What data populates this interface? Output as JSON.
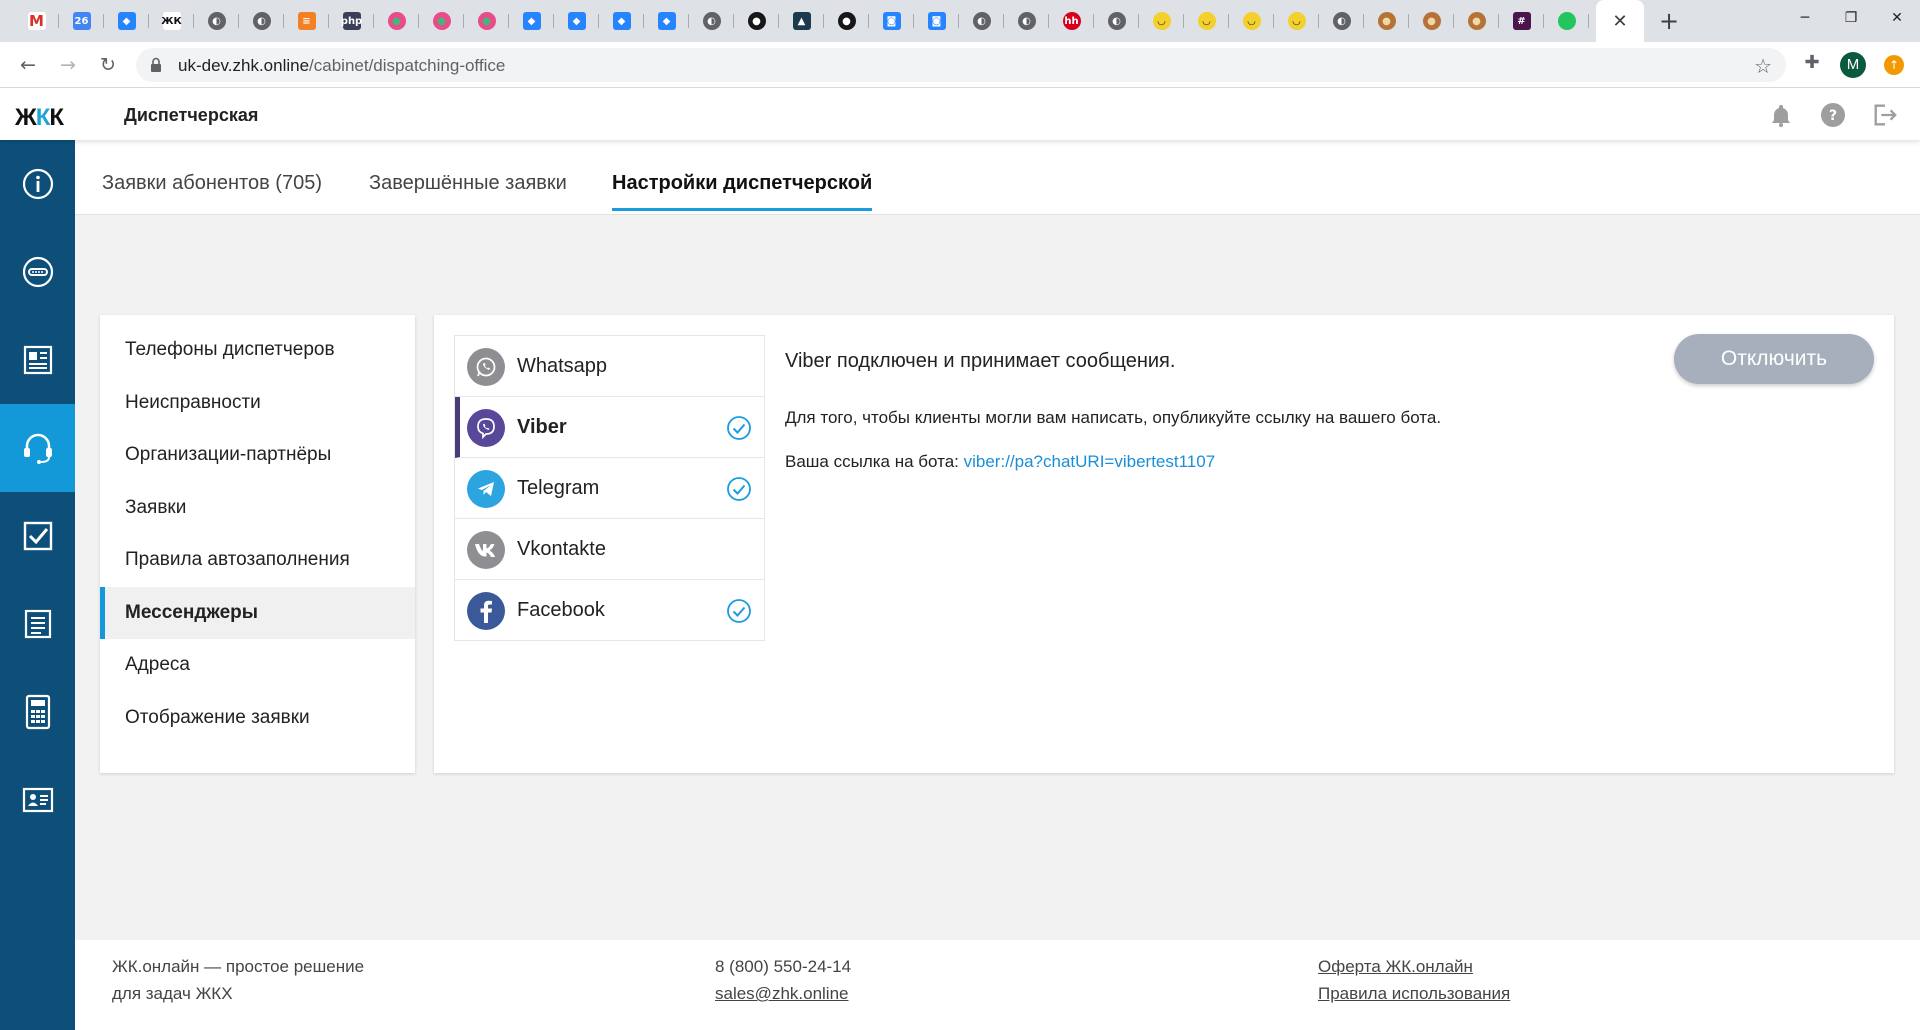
{
  "browser": {
    "url_host": "uk-dev.zhk.online",
    "url_path": "/cabinet/dispatching-office",
    "profile_initial": "M",
    "favicons": [
      {
        "icon": "gmail-icon",
        "color": "#ffffff",
        "text": "M",
        "fg": "#d93025"
      },
      {
        "icon": "calendar-icon",
        "color": "#4285f4",
        "text": "26",
        "fg": "#ffffff"
      },
      {
        "icon": "jira-icon",
        "color": "#2684ff",
        "text": "◆",
        "fg": "#ffffff"
      },
      {
        "icon": "zhk-icon",
        "color": "#ffffff",
        "text": "ЖК",
        "fg": "#111111"
      },
      {
        "icon": "globe-icon",
        "color": "#5f6368",
        "text": "◐",
        "fg": "#ffffff"
      },
      {
        "icon": "globe-icon",
        "color": "#5f6368",
        "text": "◐",
        "fg": "#ffffff"
      },
      {
        "icon": "stackoverflow-icon",
        "color": "#f48024",
        "text": "≡",
        "fg": "#ffffff"
      },
      {
        "icon": "php-icon",
        "color": "#3a3f58",
        "text": "php",
        "fg": "#ffffff"
      },
      {
        "icon": "dots-icon",
        "color": "#e94b8b",
        "text": "●",
        "fg": "#43b77a"
      },
      {
        "icon": "dots-icon",
        "color": "#e94b8b",
        "text": "●",
        "fg": "#43b77a"
      },
      {
        "icon": "dots-icon",
        "color": "#e94b8b",
        "text": "●",
        "fg": "#43b77a"
      },
      {
        "icon": "jira-icon",
        "color": "#2684ff",
        "text": "◆",
        "fg": "#ffffff"
      },
      {
        "icon": "jira-icon",
        "color": "#2684ff",
        "text": "◆",
        "fg": "#ffffff"
      },
      {
        "icon": "jira-icon",
        "color": "#2684ff",
        "text": "◆",
        "fg": "#ffffff"
      },
      {
        "icon": "jira-icon",
        "color": "#2684ff",
        "text": "◆",
        "fg": "#ffffff"
      },
      {
        "icon": "globe-icon",
        "color": "#5f6368",
        "text": "◐",
        "fg": "#ffffff"
      },
      {
        "icon": "github-icon",
        "color": "#181717",
        "text": "●",
        "fg": "#ffffff"
      },
      {
        "icon": "fire-icon",
        "color": "#1b3a4b",
        "text": "▲",
        "fg": "#ffffff"
      },
      {
        "icon": "github-icon",
        "color": "#181717",
        "text": "●",
        "fg": "#ffffff"
      },
      {
        "icon": "bitbucket-icon",
        "color": "#2684ff",
        "text": "◙",
        "fg": "#ffffff"
      },
      {
        "icon": "bitbucket-icon",
        "color": "#2684ff",
        "text": "◙",
        "fg": "#ffffff"
      },
      {
        "icon": "globe-icon",
        "color": "#5f6368",
        "text": "◐",
        "fg": "#ffffff"
      },
      {
        "icon": "globe-icon",
        "color": "#5f6368",
        "text": "◐",
        "fg": "#ffffff"
      },
      {
        "icon": "hh-icon",
        "color": "#d6001c",
        "text": "hh",
        "fg": "#ffffff"
      },
      {
        "icon": "globe-icon",
        "color": "#5f6368",
        "text": "◐",
        "fg": "#ffffff"
      },
      {
        "icon": "smiley-icon",
        "color": "#f3d02c",
        "text": "◡",
        "fg": "#222222"
      },
      {
        "icon": "smiley-icon",
        "color": "#f3d02c",
        "text": "◡",
        "fg": "#222222"
      },
      {
        "icon": "smiley-icon",
        "color": "#f3d02c",
        "text": "◡",
        "fg": "#222222"
      },
      {
        "icon": "smiley-icon",
        "color": "#f3d02c",
        "text": "◡",
        "fg": "#222222"
      },
      {
        "icon": "globe-icon",
        "color": "#5f6368",
        "text": "◐",
        "fg": "#ffffff"
      },
      {
        "icon": "dog-icon",
        "color": "#b5733a",
        "text": "●",
        "fg": "#f3d7a3"
      },
      {
        "icon": "dog-icon",
        "color": "#b5733a",
        "text": "●",
        "fg": "#f3d7a3"
      },
      {
        "icon": "dog-icon",
        "color": "#b5733a",
        "text": "●",
        "fg": "#f3d7a3"
      },
      {
        "icon": "slack-icon",
        "color": "#4a154b",
        "text": "#",
        "fg": "#ffffff"
      },
      {
        "icon": "green-dot-icon",
        "color": "#22c55e",
        "text": "",
        "fg": "#ffffff"
      }
    ]
  },
  "app": {
    "logo_left": "Ж",
    "logo_mid": "К",
    "logo_right": "К",
    "header_title": "Диспетчерская"
  },
  "page_tabs": [
    {
      "label": "Заявки абонентов (705)"
    },
    {
      "label": "Завершённые заявки"
    },
    {
      "label": "Настройки диспетчерской"
    }
  ],
  "settings_menu": [
    {
      "label": "Телефоны диспетчеров"
    },
    {
      "label": "Неисправности"
    },
    {
      "label": "Организации-партнёры"
    },
    {
      "label": "Заявки"
    },
    {
      "label": "Правила автозаполнения"
    },
    {
      "label": "Мессенджеры"
    },
    {
      "label": "Адреса"
    },
    {
      "label": "Отображение заявки"
    }
  ],
  "messengers": [
    {
      "label": "Whatsapp",
      "connected": false,
      "color": "#8e8e93"
    },
    {
      "label": "Viber",
      "connected": true,
      "color": "#59479a"
    },
    {
      "label": "Telegram",
      "connected": true,
      "color": "#2ba4e0"
    },
    {
      "label": "Vkontakte",
      "connected": false,
      "color": "#8e8e93"
    },
    {
      "label": "Facebook",
      "connected": true,
      "color": "#3b5998"
    }
  ],
  "details": {
    "status": "Viber подключен и принимает сообщения.",
    "info": "Для того, чтобы клиенты могли вам написать, опубликуйте ссылку на вашего бота.",
    "link_label": "Ваша ссылка на бота: ",
    "link_url": "viber://pa?chatURI=vibertest1107",
    "disconnect_label": "Отключить"
  },
  "footer": {
    "slogan_line1": "ЖК.онлайн — простое решение",
    "slogan_line2": "для задач ЖКХ",
    "phone": "8 (800) 550-24-14",
    "email": "sales@zhk.online",
    "offer": "Оферта ЖК.онлайн",
    "rules": "Правила использования"
  },
  "colors": {
    "sidebar": "#0e4f79",
    "sidebar_active": "#1399d8",
    "accent": "#1a9be0",
    "button_disabled": "#a6afbb"
  }
}
